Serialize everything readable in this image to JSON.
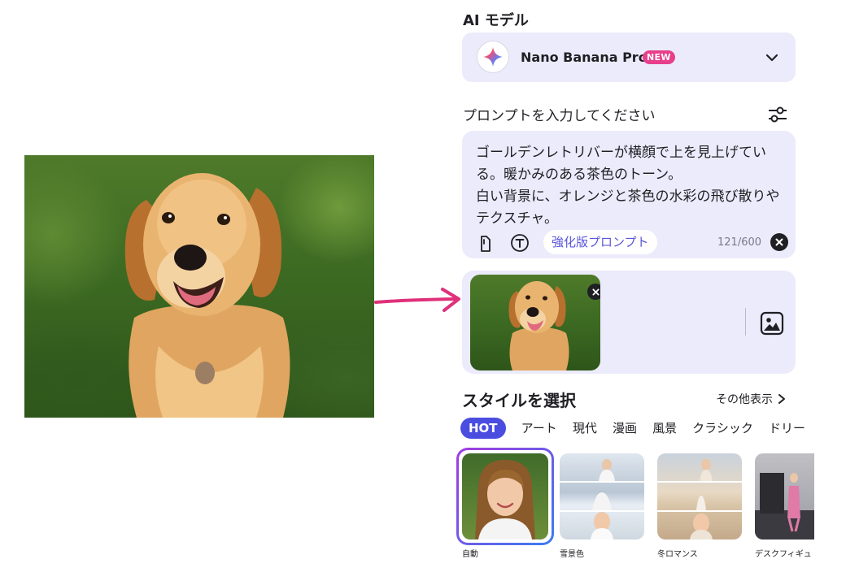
{
  "model": {
    "section_title": "AI モデル",
    "name": "Nano Banana Pro",
    "badge": "NEW",
    "icon": "gemini-sparkle-icon"
  },
  "prompt": {
    "section_title": "プロンプトを入力してください",
    "text": "ゴールデンレトリバーが横顔で上を見上げている。暖かみのある茶色のトーン。\n白い背景に、オレンジと茶色の水彩の飛び散りやテクスチャ。",
    "enhance_label": "強化版プロンプト",
    "char_count": "121/600"
  },
  "style": {
    "section_title": "スタイルを選択",
    "more_label": "その他表示",
    "tabs": [
      "HOT",
      "アート",
      "現代",
      "漫画",
      "風景",
      "クラシック",
      "ドリー"
    ],
    "active_tab": "HOT",
    "cards": [
      {
        "label": "自動",
        "selected": true
      },
      {
        "label": "雪景色",
        "selected": false
      },
      {
        "label": "冬ロマンス",
        "selected": false
      },
      {
        "label": "デスクフィギュ",
        "selected": false
      }
    ]
  },
  "colors": {
    "accent": "#4a4de0",
    "panel": "#ecebfb",
    "arrow": "#e0307a",
    "badge": "#e83f8c"
  }
}
